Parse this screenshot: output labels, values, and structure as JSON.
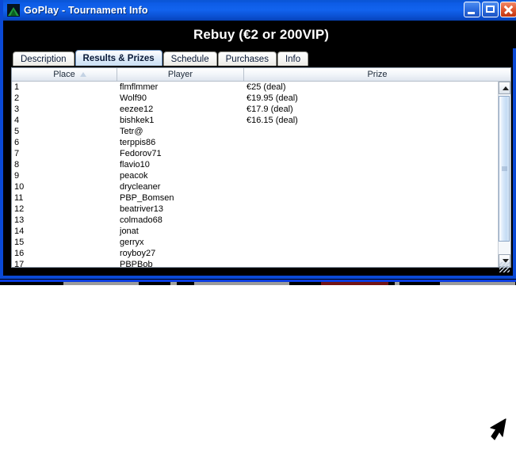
{
  "window": {
    "title": "GoPlay - Tournament Info",
    "icon": "goplay-app-icon",
    "minimize_label": "Minimize",
    "maximize_label": "Maximize",
    "close_label": "Close"
  },
  "heading": {
    "text": "Rebuy (€2 or 200VIP)"
  },
  "tabs": [
    {
      "label": "Description",
      "active": false
    },
    {
      "label": "Results & Prizes",
      "active": true
    },
    {
      "label": "Schedule",
      "active": false
    },
    {
      "label": "Purchases",
      "active": false
    },
    {
      "label": "Info",
      "active": false
    }
  ],
  "table": {
    "columns": [
      "Place",
      "Player",
      "Prize"
    ],
    "sort_column": "Place",
    "sort_direction": "ascending",
    "rows": [
      {
        "place": "1",
        "player": "flmflmmer",
        "prize": "€25 (deal)"
      },
      {
        "place": "2",
        "player": "Wolf90",
        "prize": "€19.95 (deal)"
      },
      {
        "place": "3",
        "player": "eezee12",
        "prize": "€17.9 (deal)"
      },
      {
        "place": "4",
        "player": "bishkek1",
        "prize": "€16.15 (deal)"
      },
      {
        "place": "5",
        "player": "Tetr@",
        "prize": ""
      },
      {
        "place": "6",
        "player": "terppis86",
        "prize": ""
      },
      {
        "place": "7",
        "player": "Fedorov71",
        "prize": ""
      },
      {
        "place": "8",
        "player": "flavio10",
        "prize": ""
      },
      {
        "place": "9",
        "player": "peacok",
        "prize": ""
      },
      {
        "place": "10",
        "player": "drycleaner",
        "prize": ""
      },
      {
        "place": "11",
        "player": "PBP_Bomsen",
        "prize": ""
      },
      {
        "place": "12",
        "player": "beatriver13",
        "prize": ""
      },
      {
        "place": "13",
        "player": "colmado68",
        "prize": ""
      },
      {
        "place": "14",
        "player": "jonat",
        "prize": ""
      },
      {
        "place": "15",
        "player": "gerryx",
        "prize": ""
      },
      {
        "place": "16",
        "player": "royboy27",
        "prize": ""
      },
      {
        "place": "17",
        "player": "PBPBob",
        "prize": ""
      }
    ]
  },
  "scrollbar": {
    "up_arrow": "scroll-up-arrow",
    "down_arrow": "scroll-down-arrow"
  },
  "colors": {
    "titlebar": "#0d5ce6",
    "frame": "#0a49d6",
    "content_bg": "#000000",
    "tab_active": "#c9dff5",
    "close_button": "#e25b33"
  }
}
